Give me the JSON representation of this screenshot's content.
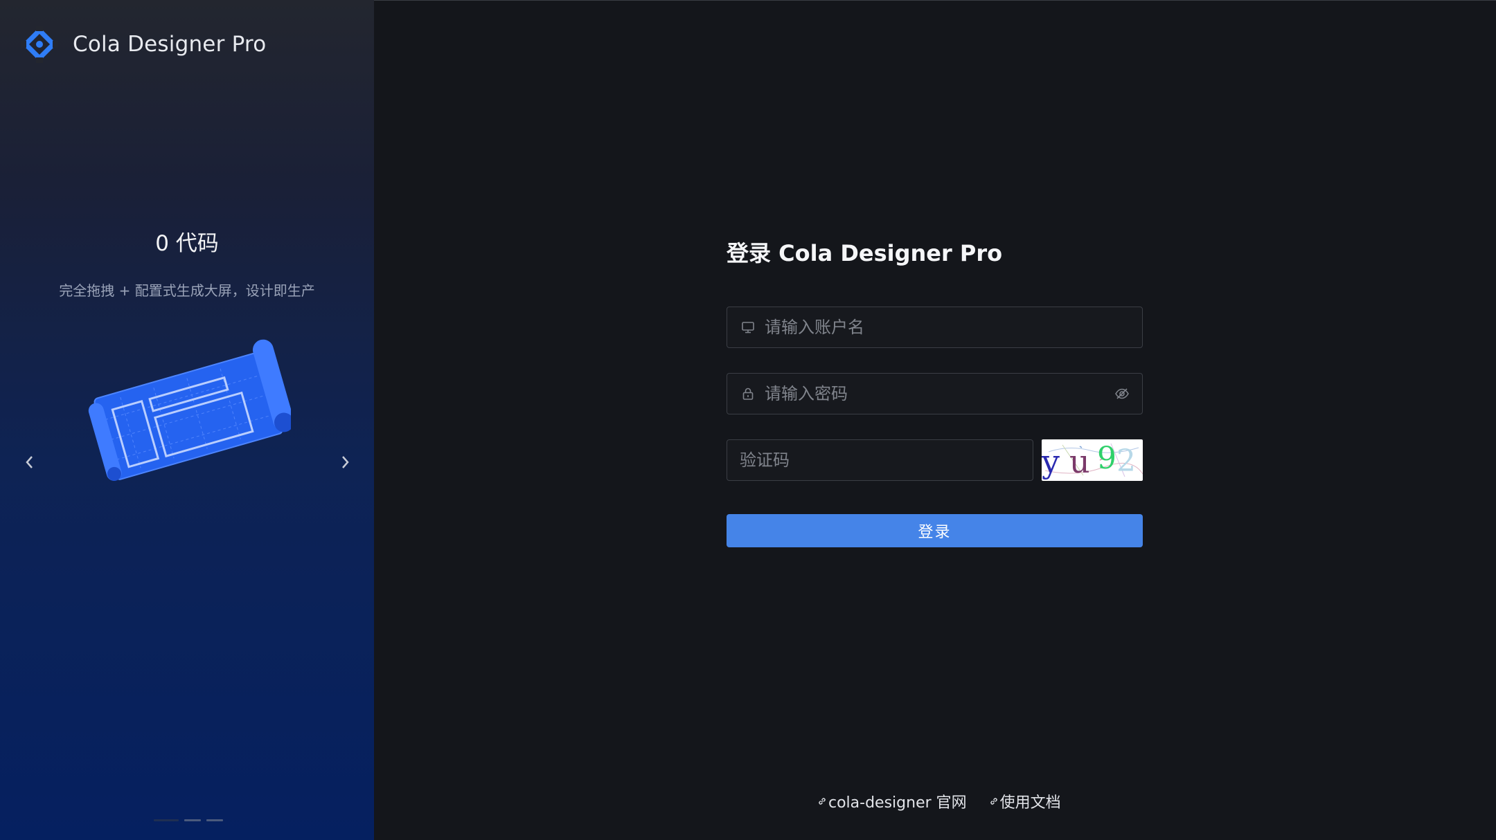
{
  "app": {
    "brand_name": "Cola Designer Pro"
  },
  "carousel": {
    "slide_title": "0 代码",
    "slide_subtitle": "完全拖拽 + 配置式生成大屏，设计即生产",
    "slide_count": 3,
    "active_index": 0
  },
  "login": {
    "title": "登录 Cola Designer Pro",
    "username_placeholder": "请输入账户名",
    "password_placeholder": "请输入密码",
    "captcha_placeholder": "验证码",
    "captcha_text": "yu92",
    "submit_label": "登录"
  },
  "footer": {
    "links": [
      {
        "label": "cola-designer 官网"
      },
      {
        "label": "使用文档"
      }
    ]
  },
  "colors": {
    "accent": "#4584e8",
    "logo": "#2f7df6",
    "page_bg": "#14161b",
    "panel_bottom": "#052060"
  }
}
